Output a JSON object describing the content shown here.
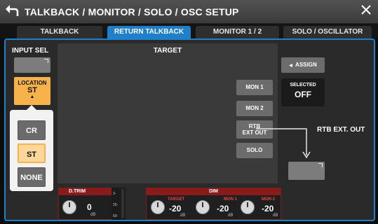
{
  "window": {
    "title": "TALKBACK / MONITOR / SOLO / OSC SETUP"
  },
  "tabs": [
    {
      "label": "TALKBACK",
      "active": false
    },
    {
      "label": "RETURN TALKBACK",
      "active": true
    },
    {
      "label": "MONITOR 1 / 2",
      "active": false
    },
    {
      "label": "SOLO / OSCILLATOR",
      "active": false
    }
  ],
  "input_sel": {
    "title": "INPUT SEL",
    "location": {
      "label": "LOCATION",
      "value": "ST"
    },
    "options": [
      "CR",
      "ST",
      "NONE"
    ],
    "selected_option": "ST"
  },
  "target": {
    "title": "TARGET",
    "buttons": [
      {
        "line1": "MON 1",
        "line2": ""
      },
      {
        "line1": "MON 2",
        "line2": ""
      },
      {
        "line1": "RTB",
        "line2": "EXT OUT"
      },
      {
        "line1": "SOLO",
        "line2": ""
      }
    ]
  },
  "assign": {
    "label": "ASSIGN"
  },
  "selected": {
    "label": "SELECTED",
    "value": "OFF"
  },
  "rtb_ext_out": {
    "title": "RTB EXT. OUT"
  },
  "dtrim": {
    "label": "D.TRIM",
    "value": "0",
    "unit": "dB"
  },
  "meter": {
    "marks": [
      "3-",
      "20-",
      "60-"
    ]
  },
  "dim": {
    "label": "DIM",
    "items": [
      {
        "label": "TARGET",
        "value": "-20",
        "unit": "dB"
      },
      {
        "label": "MON 1",
        "value": "-20",
        "unit": "dB"
      },
      {
        "label": "MON 2",
        "value": "-20",
        "unit": "dB"
      }
    ]
  },
  "colors": {
    "accent": "#1f7fc8",
    "location": "#f7b24b",
    "dim_header": "#8a1b1b"
  }
}
